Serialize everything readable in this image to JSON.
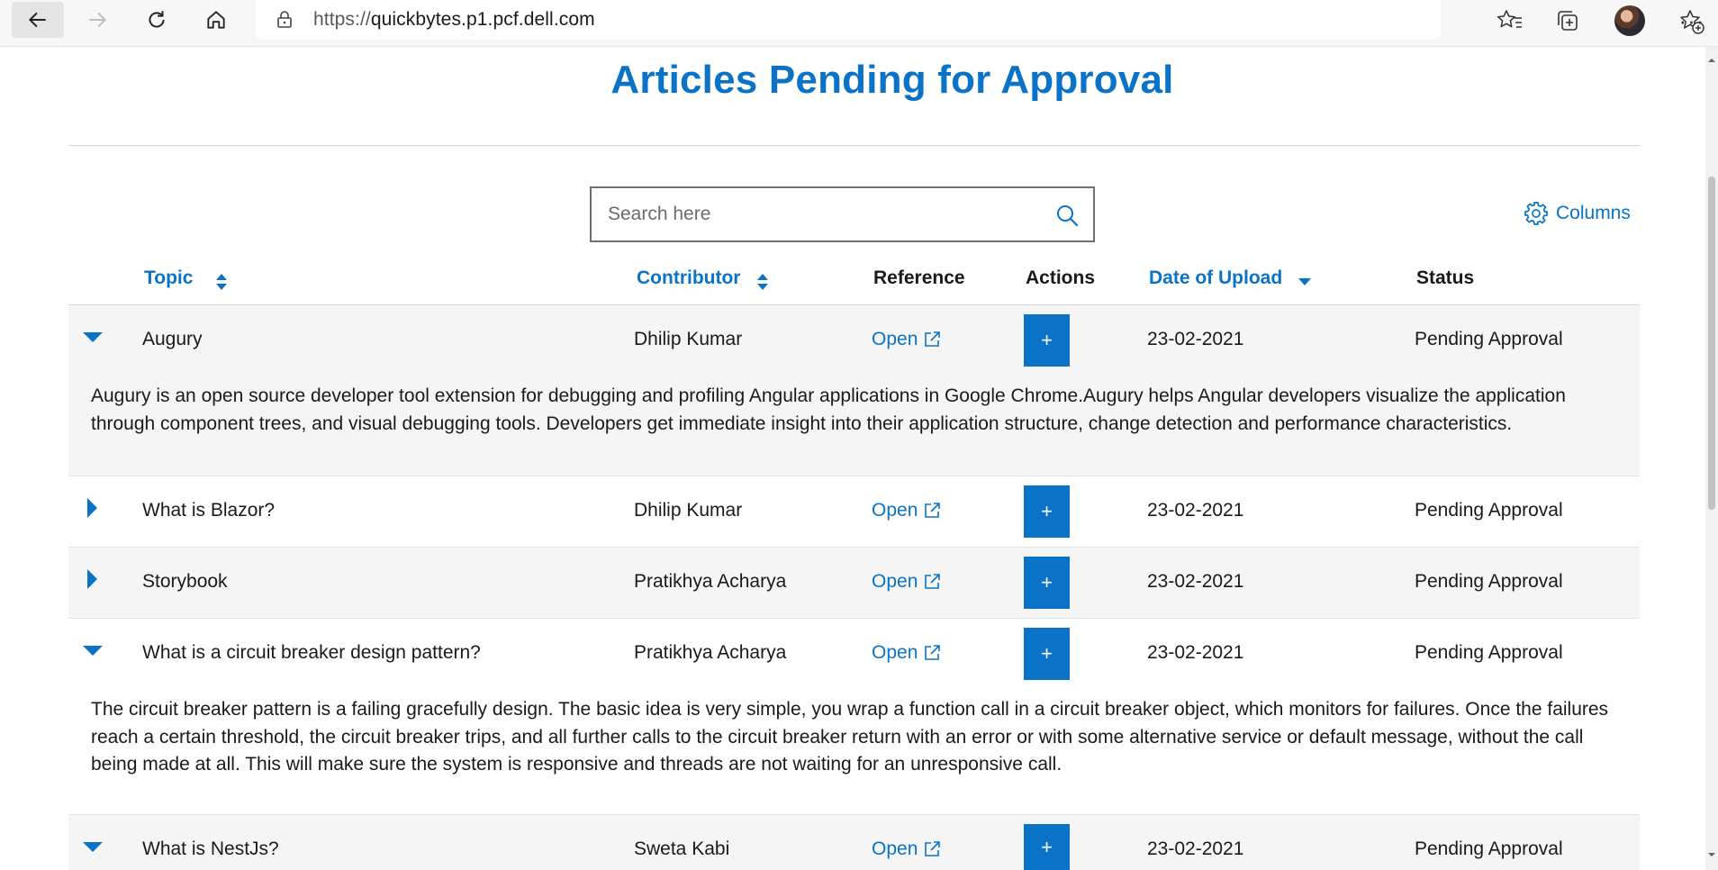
{
  "browser": {
    "url_protocol": "https://",
    "url_host": "quickbytes.p1.pcf.dell.com"
  },
  "page": {
    "title": "Articles Pending for Approval",
    "search_placeholder": "Search here",
    "columns_label": "Columns"
  },
  "table": {
    "headers": {
      "topic": "Topic",
      "contributor": "Contributor",
      "reference": "Reference",
      "actions": "Actions",
      "date": "Date of Upload",
      "status": "Status"
    },
    "rows": [
      {
        "topic": "Augury",
        "contributor": "Dhilip Kumar",
        "reference": "Open",
        "action": "+",
        "date": "23-02-2021",
        "status": "Pending Approval",
        "expanded": true,
        "description": "Augury is an open source developer tool extension for debugging and profiling Angular applications in Google Chrome.Augury helps Angular developers visualize the application through component trees, and visual debugging tools. Developers get immediate insight into their application structure, change detection and performance characteristics."
      },
      {
        "topic": "What is Blazor?",
        "contributor": "Dhilip Kumar",
        "reference": "Open",
        "action": "+",
        "date": "23-02-2021",
        "status": "Pending Approval",
        "expanded": false
      },
      {
        "topic": "Storybook",
        "contributor": "Pratikhya Acharya",
        "reference": "Open",
        "action": "+",
        "date": "23-02-2021",
        "status": "Pending Approval",
        "expanded": false
      },
      {
        "topic": "What is a circuit breaker design pattern?",
        "contributor": "Pratikhya Acharya",
        "reference": "Open",
        "action": "+",
        "date": "23-02-2021",
        "status": "Pending Approval",
        "expanded": true,
        "description": "The circuit breaker pattern is a failing gracefully design. The basic idea is very simple, you wrap a function call in a circuit breaker object, which monitors for failures. Once the failures reach a certain threshold, the circuit breaker trips, and all further calls to the circuit breaker return with an error or with some alternative service or default message, without the call being made at all. This will make sure the system is responsive and threads are not waiting for an unresponsive call."
      },
      {
        "topic": "What is NestJs?",
        "contributor": "Sweta Kabi",
        "reference": "Open",
        "action": "+",
        "date": "23-02-2021",
        "status": "Pending Approval",
        "expanded": true
      }
    ]
  },
  "colors": {
    "accent": "#0a73c7",
    "row_alt": "#f5f5f5"
  }
}
